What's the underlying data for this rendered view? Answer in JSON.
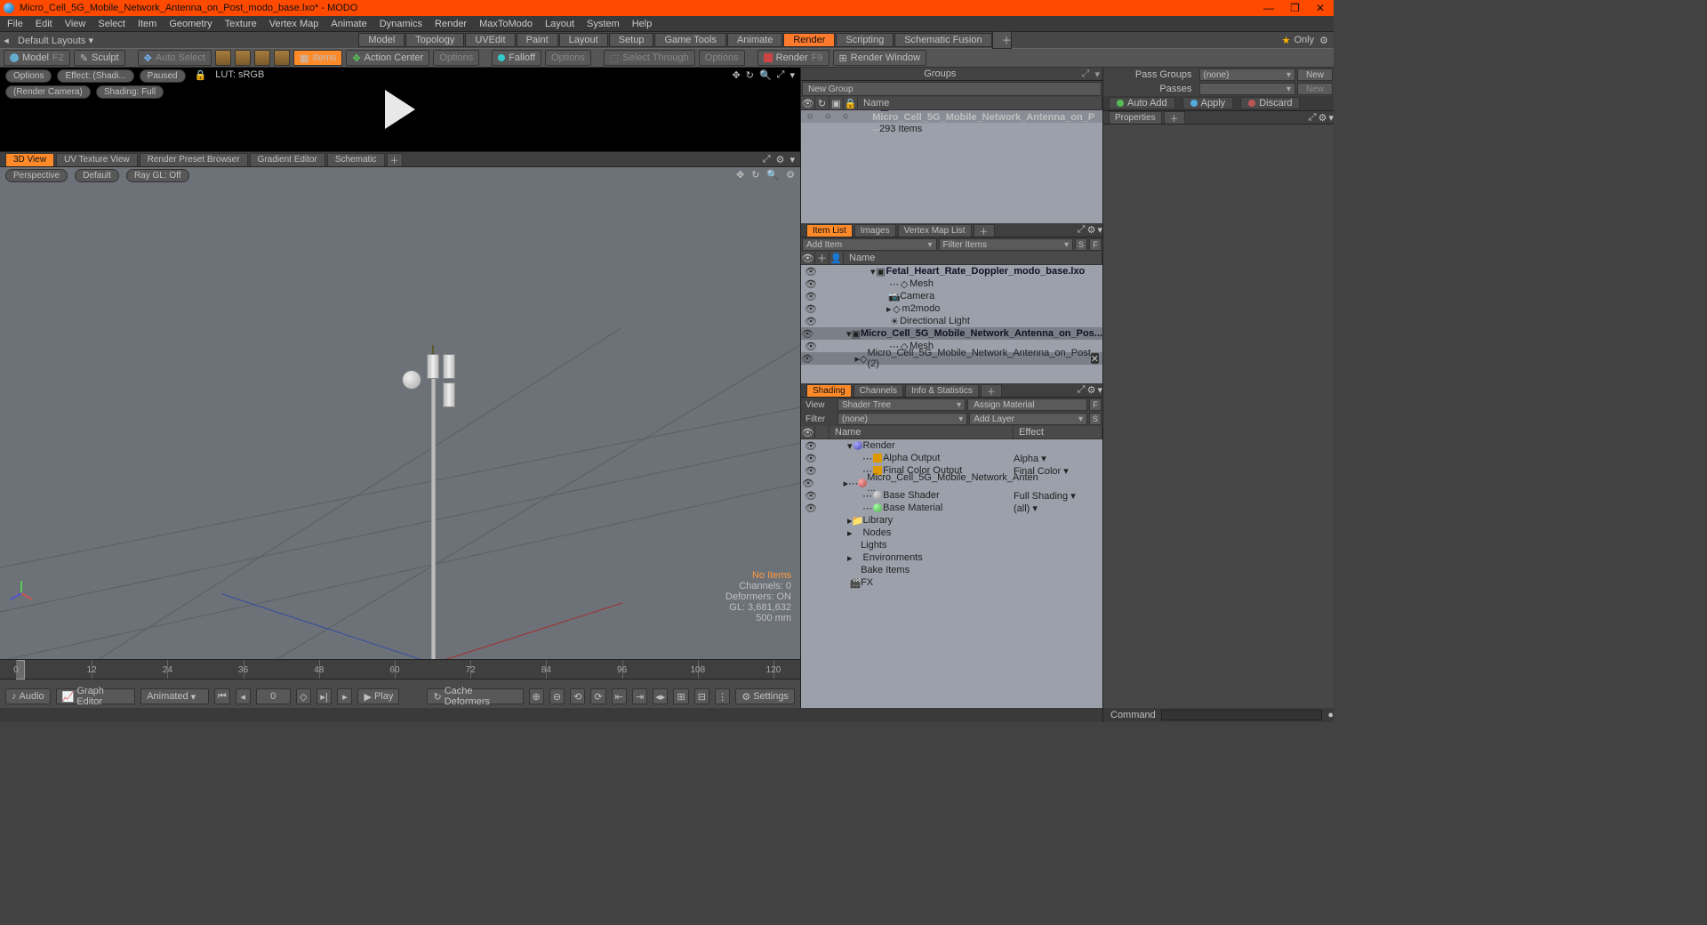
{
  "app": {
    "title": "Micro_Cell_5G_Mobile_Network_Antenna_on_Post_modo_base.lxo* - MODO"
  },
  "menu": [
    "File",
    "Edit",
    "View",
    "Select",
    "Item",
    "Geometry",
    "Texture",
    "Vertex Map",
    "Animate",
    "Dynamics",
    "Render",
    "MaxToModo",
    "Layout",
    "System",
    "Help"
  ],
  "layout": {
    "dropdown": "Default Layouts ▾"
  },
  "modes": [
    "Model",
    "Topology",
    "UVEdit",
    "Paint",
    "Layout",
    "Setup",
    "Game Tools",
    "Animate",
    "Render",
    "Scripting",
    "Schematic Fusion"
  ],
  "modes_active": 8,
  "only": "Only",
  "tb": {
    "model": "Model",
    "model_key": "F2",
    "sculpt": "Sculpt",
    "autoselect": "Auto Select",
    "items": "Items",
    "action": "Action Center",
    "options": "Options",
    "falloff": "Falloff",
    "selthrough": "Select Through",
    "render": "Render",
    "render_key": "F9",
    "rwindow": "Render Window"
  },
  "preview": {
    "options": "Options",
    "effect": "Effect: (Shadi...",
    "paused": "Paused",
    "lut": "LUT: sRGB",
    "cam": "(Render Camera)",
    "shading": "Shading: Full"
  },
  "viewtabs": [
    "3D View",
    "UV Texture View",
    "Render Preset Browser",
    "Gradient Editor",
    "Schematic"
  ],
  "vpbar": {
    "persp": "Perspective",
    "default": "Default",
    "raygl": "Ray GL: Off"
  },
  "hud": {
    "noitems": "No Items",
    "chan": "Channels: 0",
    "def": "Deformers: ON",
    "gl": "GL: 3,681,632",
    "unit": "500 mm"
  },
  "timeline": {
    "ticks": [
      0,
      12,
      24,
      36,
      48,
      60,
      72,
      84,
      96,
      108,
      120
    ],
    "range_a": "0",
    "range_b": "120",
    "audio": "Audio",
    "graph": "Graph Editor",
    "anim": "Animated",
    "cur": "0",
    "play": "Play",
    "cache": "Cache Deformers",
    "settings": "Settings"
  },
  "groups": {
    "title": "Groups",
    "newgroup": "New Group",
    "namecol": "Name",
    "item": "Micro_Cell_5G_Mobile_Network_Antenna_on_P ...",
    "count": "293 Items"
  },
  "itemlist": {
    "tabs": [
      "Item List",
      "Images",
      "Vertex Map List"
    ],
    "add": "Add Item",
    "filter": "Filter Items",
    "namecol": "Name",
    "rows": [
      {
        "indent": 0,
        "exp": "▾",
        "icon": "scene",
        "label": "Fetal_Heart_Rate_Doppler_modo_base.lxo",
        "bold": true
      },
      {
        "indent": 1,
        "exp": "",
        "icon": "mesh",
        "label": "Mesh",
        "dash": true
      },
      {
        "indent": 1,
        "exp": "",
        "icon": "camera",
        "label": "Camera"
      },
      {
        "indent": 1,
        "exp": "▸",
        "icon": "mesh",
        "label": "m2modo"
      },
      {
        "indent": 1,
        "exp": "",
        "icon": "light",
        "label": "Directional Light"
      },
      {
        "indent": 0,
        "exp": "▾",
        "icon": "scene",
        "label": "Micro_Cell_5G_Mobile_Network_Antenna_on_Pos...",
        "bold": true,
        "sel": true
      },
      {
        "indent": 1,
        "exp": "",
        "icon": "mesh",
        "label": "Mesh",
        "dash": true
      },
      {
        "indent": 1,
        "exp": "▸",
        "icon": "mesh",
        "label": "Micro_Cell_5G_Mobile_Network_Antenna_on_Post (2)",
        "sel": true,
        "x": true
      }
    ]
  },
  "shading": {
    "tabs": [
      "Shading",
      "Channels",
      "Info & Statistics"
    ],
    "view": "View",
    "viewval": "Shader Tree",
    "assign": "Assign Material",
    "filter": "Filter",
    "filterval": "(none)",
    "addlayer": "Add Layer",
    "namecol": "Name",
    "effectcol": "Effect",
    "rows": [
      {
        "indent": 0,
        "exp": "▾",
        "icon": "ball-b",
        "label": "Render",
        "eff": ""
      },
      {
        "indent": 1,
        "exp": "",
        "icon": "sq-o",
        "label": "Alpha Output",
        "eff": "Alpha",
        "dash": true
      },
      {
        "indent": 1,
        "exp": "",
        "icon": "sq-o",
        "label": "Final Color Output",
        "eff": "Final Color",
        "dash": true
      },
      {
        "indent": 1,
        "exp": "▸",
        "icon": "ball-r",
        "label": "Micro_Cell_5G_Mobile_Network_Anten ...",
        "eff": "",
        "dash": true
      },
      {
        "indent": 1,
        "exp": "",
        "icon": "ball-g",
        "label": "Base Shader",
        "eff": "Full Shading",
        "dash": true
      },
      {
        "indent": 1,
        "exp": "",
        "icon": "ball-gr",
        "label": "Base Material",
        "eff": "(all)",
        "dash": true
      },
      {
        "indent": 0,
        "exp": "▸",
        "icon": "fold",
        "label": "Library",
        "eff": ""
      },
      {
        "indent": 0,
        "exp": "▸",
        "icon": "",
        "label": "Nodes",
        "eff": ""
      },
      {
        "indent": 0,
        "exp": "",
        "icon": "",
        "label": "Lights",
        "eff": ""
      },
      {
        "indent": 0,
        "exp": "▸",
        "icon": "",
        "label": "Environments",
        "eff": ""
      },
      {
        "indent": 0,
        "exp": "",
        "icon": "",
        "label": "Bake Items",
        "eff": ""
      },
      {
        "indent": 0,
        "exp": "",
        "icon": "clap",
        "label": "FX",
        "eff": ""
      }
    ]
  },
  "right": {
    "passgroups": "Pass Groups",
    "none": "(none)",
    "new": "New",
    "passes": "Passes",
    "autoadd": "Auto Add",
    "apply": "Apply",
    "discard": "Discard",
    "props": "Properties"
  },
  "footer": {
    "cmd": "Command"
  }
}
